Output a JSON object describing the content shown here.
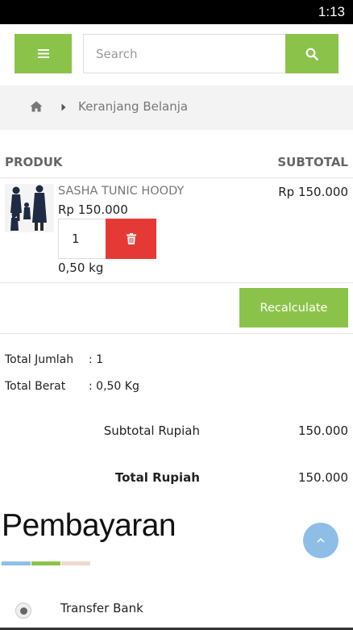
{
  "status_bar": {
    "time": "1:13"
  },
  "header": {
    "menu_icon": "hamburger-icon",
    "search_placeholder": "Search",
    "search_icon": "search-icon",
    "accent_color": "#8bc34a"
  },
  "breadcrumb": {
    "home_icon": "home-icon",
    "separator_icon": "caret-right-icon",
    "current": "Keranjang Belanja"
  },
  "cart": {
    "columns": {
      "product": "PRODUK",
      "subtotal": "SUBTOTAL"
    },
    "items": [
      {
        "name": "SASHA TUNIC HOODY",
        "price": "Rp 150.000",
        "quantity": "1",
        "weight": "0,50 kg",
        "subtotal": "Rp 150.000"
      }
    ],
    "delete_icon": "trash-icon",
    "delete_color": "#e53935",
    "recalculate_label": "Recalculate"
  },
  "summary": {
    "total_jumlah_label": "Total Jumlah",
    "total_jumlah_value": ": 1",
    "total_berat_label": "Total Berat",
    "total_berat_value": ": 0,50 Kg",
    "subtotal_label": "Subtotal Rupiah",
    "subtotal_value": "150.000",
    "total_label": "Total Rupiah",
    "total_value": "150.000"
  },
  "payment": {
    "title": "Pembayaran",
    "underline_colors": [
      "#8ebee6",
      "#8bc34a",
      "#f0d8d0"
    ],
    "options": [
      {
        "label": "Transfer Bank",
        "selected": true
      }
    ]
  },
  "scroll_top_icon": "chevron-up-icon"
}
